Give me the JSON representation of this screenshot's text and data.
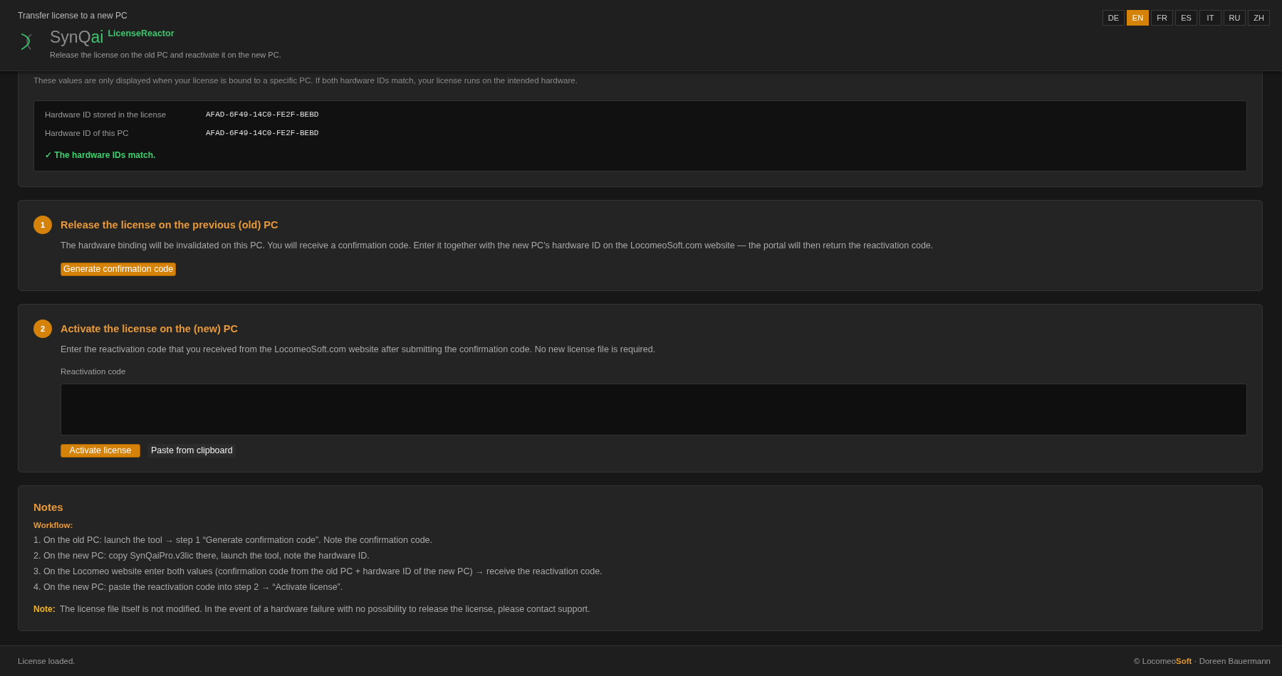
{
  "header": {
    "title": "Transfer license to a new PC",
    "brand": {
      "name": "SynQ",
      "name_accent": "ai",
      "product": "LicenseReactor"
    },
    "subtitle": "Release the license on the old PC and reactivate it on the new PC.",
    "languages": [
      {
        "label": "DE",
        "selected": false
      },
      {
        "label": "EN",
        "selected": true
      },
      {
        "label": "FR",
        "selected": false
      },
      {
        "label": "ES",
        "selected": false
      },
      {
        "label": "IT",
        "selected": false
      },
      {
        "label": "RU",
        "selected": false
      },
      {
        "label": "ZH",
        "selected": false
      }
    ]
  },
  "hardware": {
    "description": "These values are only displayed when your license is bound to a specific PC. If both hardware IDs match, your license runs on the intended hardware.",
    "rows": [
      {
        "label": "Hardware ID stored in the license",
        "value": "AFAD-6F49-14C0-FE2F-BEBD"
      },
      {
        "label": "Hardware ID of this PC",
        "value": "AFAD-6F49-14C0-FE2F-BEBD"
      }
    ],
    "status": {
      "kind": "ok",
      "text": "✓ The hardware IDs match."
    }
  },
  "steps": [
    {
      "number": "1",
      "title": "Release the license on the previous (old) PC",
      "description": "The hardware binding will be invalidated on this PC. You will receive a confirmation code. Enter it together with the new PC's hardware ID on the LocomeoSoft.com website — the portal will then return the reactivation code.",
      "buttons": [
        {
          "label": "Generate confirmation code",
          "kind": "primary"
        }
      ]
    },
    {
      "number": "2",
      "title": "Activate the license on the (new) PC",
      "description": "Enter the reactivation code that you received from the LocomeoSoft.com website after submitting the confirmation code. No new license file is required.",
      "field": {
        "label": "Reactivation code"
      },
      "buttons": [
        {
          "label": "Activate license",
          "kind": "primary"
        },
        {
          "label": "Paste from clipboard",
          "kind": "secondary"
        }
      ]
    }
  ],
  "notes": {
    "title": "Notes",
    "subtitle": "Workflow:",
    "items": [
      "1. On the old PC: launch the tool → step 1 “Generate confirmation code”. Note the confirmation code.",
      "2. On the new PC: copy SynQaiPro.v3lic there, launch the tool, note the hardware ID.",
      "3. On the Locomeo website enter both values (confirmation code from the old PC + hardware ID of the new PC) → receive the reactivation code.",
      "4. On the new PC: paste the reactivation code into step 2 → “Activate license”."
    ],
    "note": {
      "label": "Note:",
      "text": "The license file itself is not modified. In the event of a hardware failure with no possibility to release the license, please contact support."
    }
  },
  "status_bar": {
    "message": "License loaded.",
    "copyright": "© Locomeo**Soft** · Doreen Bauermann"
  }
}
